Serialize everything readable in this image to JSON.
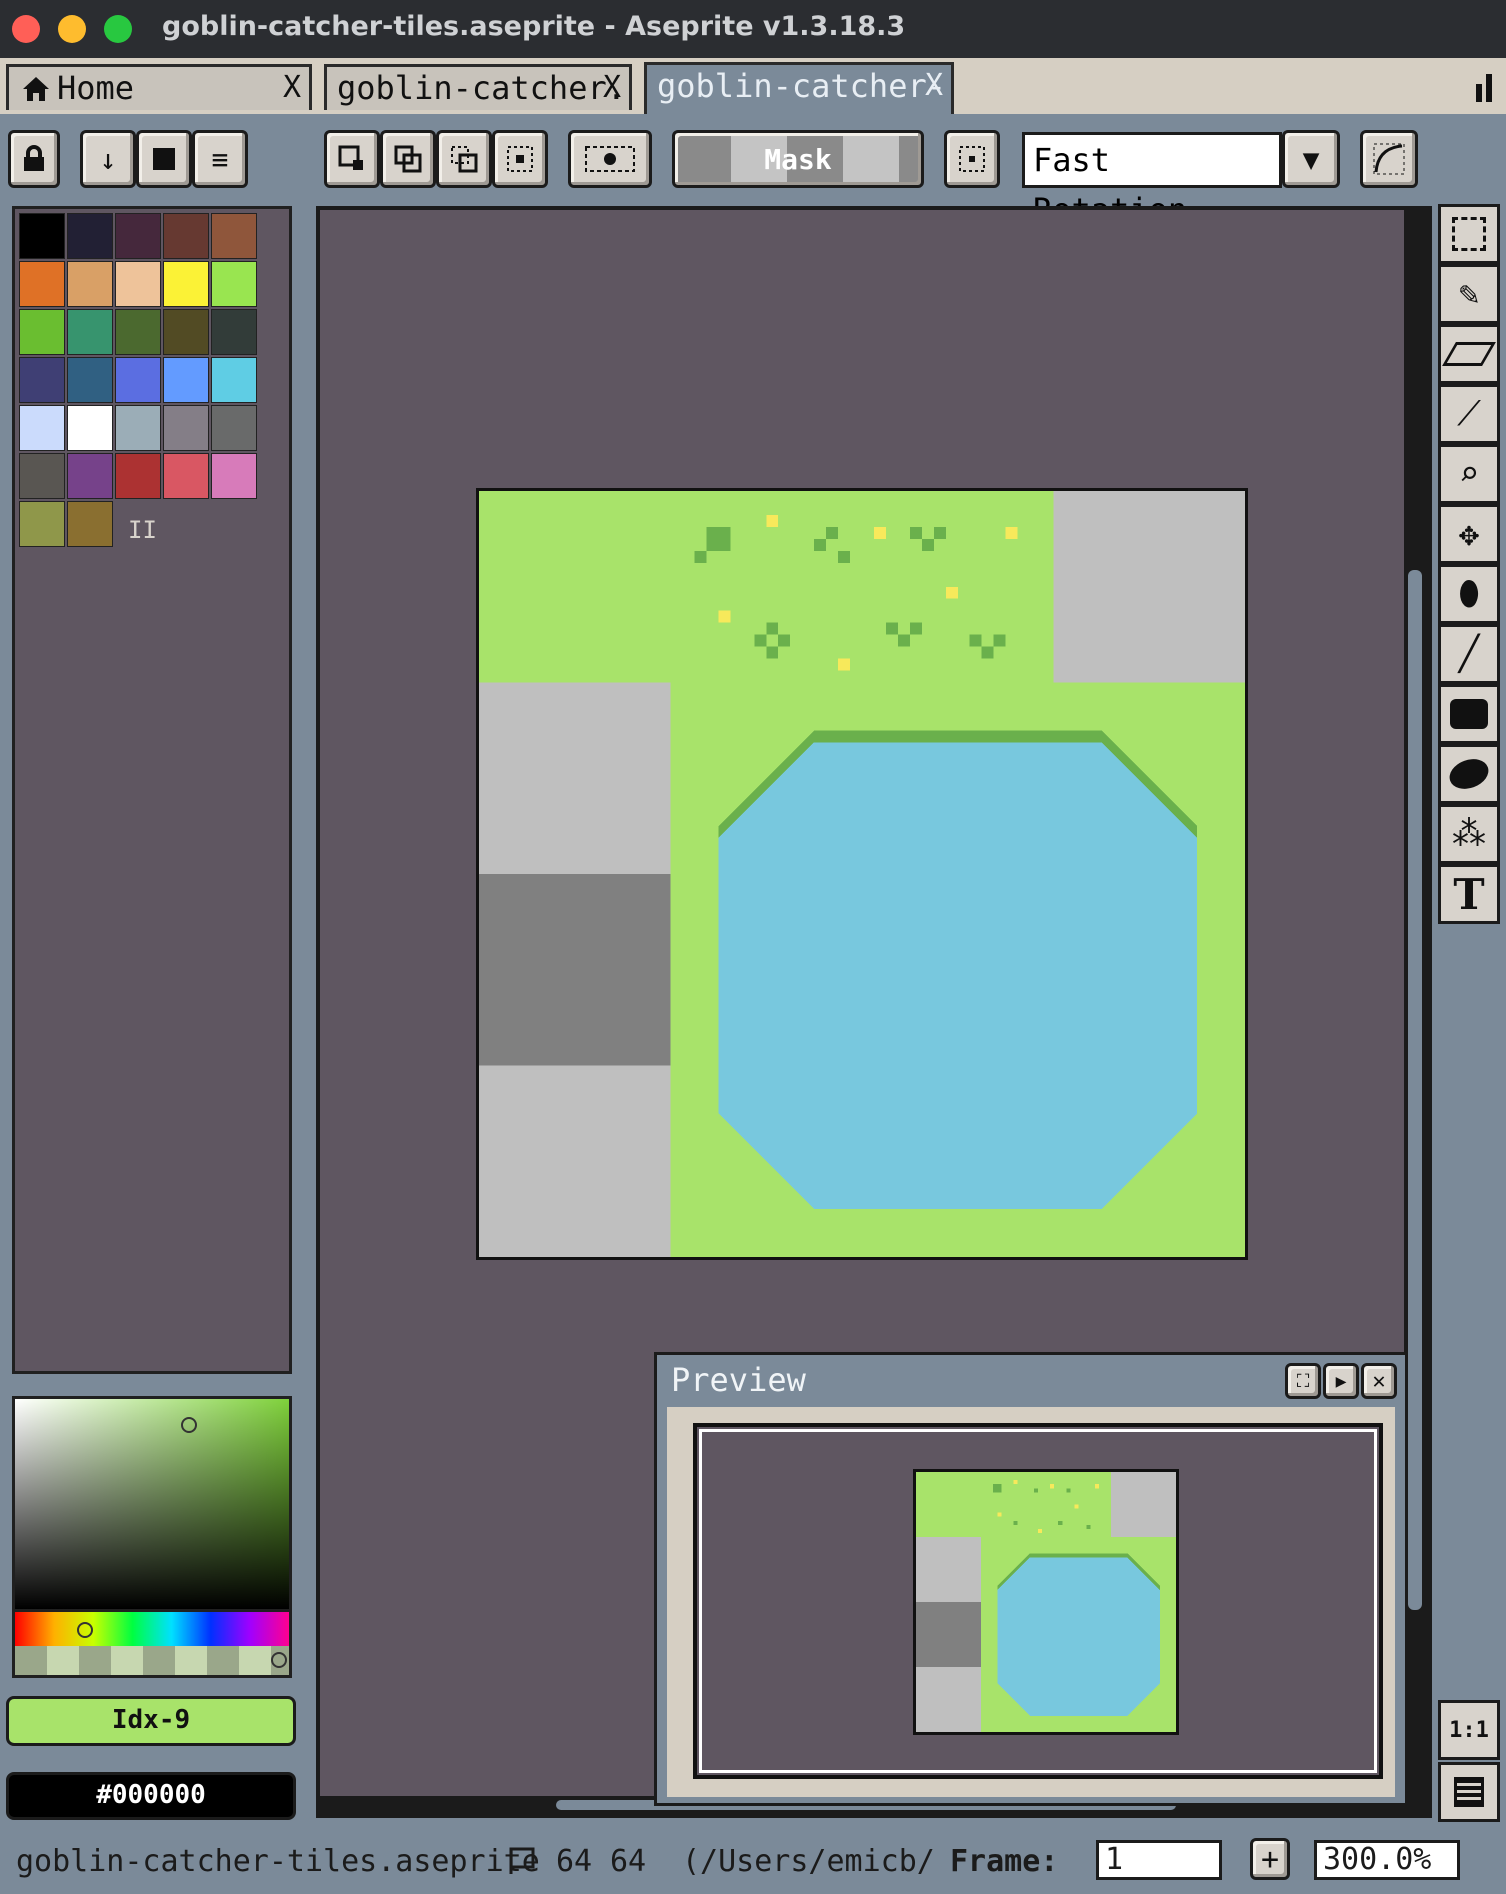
{
  "window": {
    "title": "goblin-catcher-tiles.aseprite - Aseprite v1.3.18.3"
  },
  "tabs": [
    {
      "label": "Home",
      "close": "X"
    },
    {
      "label": "goblin-catcher.",
      "close": "X"
    },
    {
      "label": "goblin-catcher-",
      "close": "X"
    }
  ],
  "toolbar": {
    "lock_icon": "lock-icon",
    "mask_label": "Mask",
    "rotation_select": "Fast Rotation"
  },
  "palette": {
    "colors": [
      "#000000",
      "#222034",
      "#45283c",
      "#663931",
      "#8f563b",
      "#df7126",
      "#d9a066",
      "#eec39a",
      "#fbf236",
      "#99e550",
      "#6abe30",
      "#37946e",
      "#4b692f",
      "#524b24",
      "#323c39",
      "#3f3f74",
      "#306082",
      "#5b6ee1",
      "#639bff",
      "#5fcde4",
      "#cbdbfc",
      "#ffffff",
      "#9badb7",
      "#847e87",
      "#696a6a",
      "#595652",
      "#76428a",
      "#ac3232",
      "#d95763",
      "#d77bba",
      "#8f974a",
      "#8a6f30"
    ]
  },
  "color_picker": {
    "fg_index_label": "Idx-9",
    "bg_hex_label": "#000000",
    "fg_color": "#a8e36a",
    "bg_color": "#000000"
  },
  "preview": {
    "title": "Preview"
  },
  "tools": [
    "marquee-tool",
    "pencil-tool",
    "eraser-tool",
    "eyedropper-tool",
    "zoom-tool",
    "move-tool",
    "paint-bucket-tool",
    "line-tool",
    "rectangle-tool",
    "contour-tool",
    "blur-tool",
    "text-tool"
  ],
  "status": {
    "filename": "goblin-catcher-tiles.aseprite",
    "size_w": "64",
    "size_h": "64",
    "path": "(/Users/emicb/",
    "frame_label": "Frame:",
    "frame_value": "1",
    "zoom": "300.0%",
    "ratio_button": "1:1"
  }
}
